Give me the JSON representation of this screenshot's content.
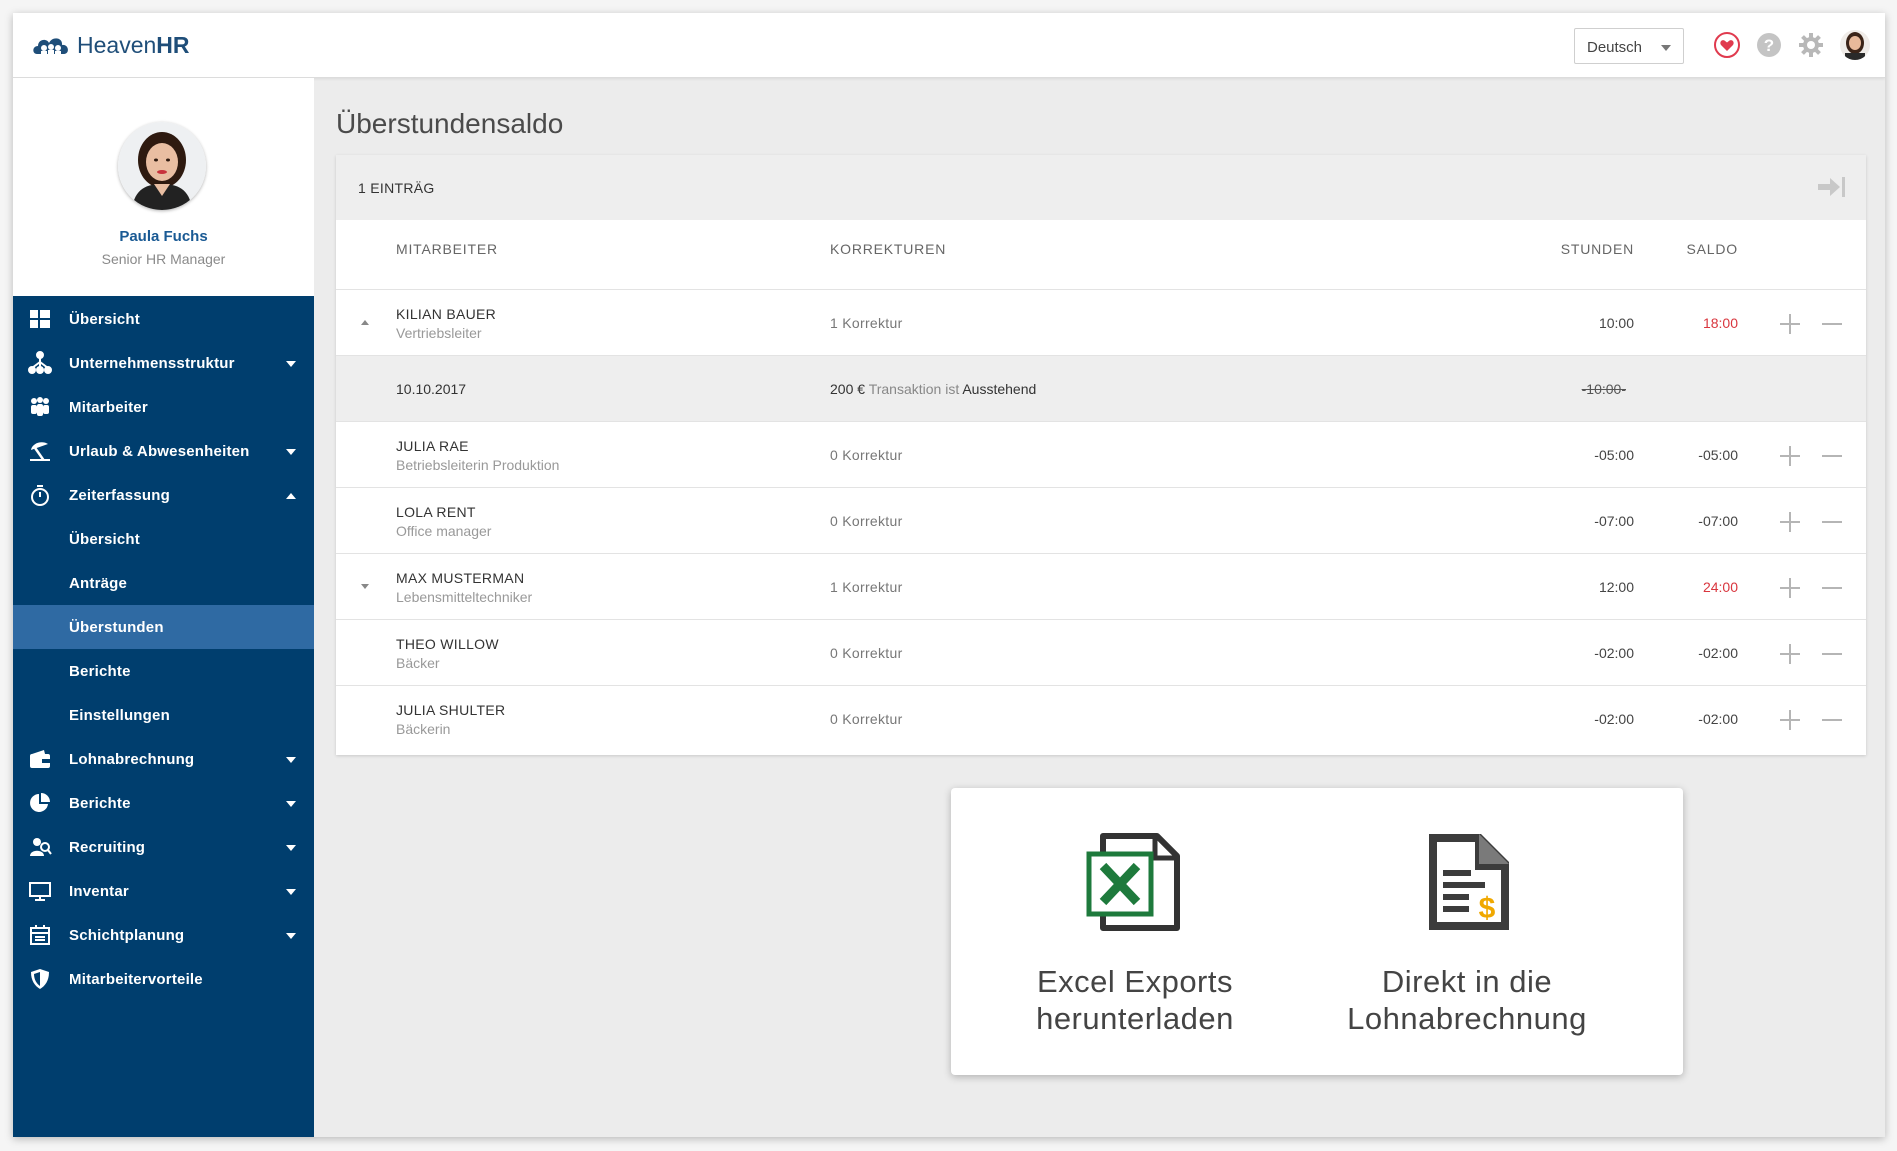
{
  "header": {
    "brand_light": "Heaven",
    "brand_bold": "HR",
    "language": "Deutsch"
  },
  "profile": {
    "name": "Paula Fuchs",
    "role": "Senior HR Manager"
  },
  "sidebar": {
    "items": [
      {
        "label": "Übersicht",
        "icon": "dashboard-icon",
        "dropdown": false
      },
      {
        "label": "Unternehmensstruktur",
        "icon": "org-structure-icon",
        "dropdown": true
      },
      {
        "label": "Mitarbeiter",
        "icon": "people-icon",
        "dropdown": false
      },
      {
        "label": "Urlaub & Abwesenheiten",
        "icon": "beach-umbrella-icon",
        "dropdown": true
      },
      {
        "label": "Zeiterfassung",
        "icon": "stopwatch-icon",
        "dropdown": true,
        "expanded": true
      },
      {
        "label": "Übersicht",
        "sub": true
      },
      {
        "label": "Anträge",
        "sub": true
      },
      {
        "label": "Überstunden",
        "sub": true,
        "active": true
      },
      {
        "label": "Berichte",
        "sub": true
      },
      {
        "label": "Einstellungen",
        "sub": true
      },
      {
        "label": "Lohnabrechnung",
        "icon": "wallet-icon",
        "dropdown": true
      },
      {
        "label": "Berichte",
        "icon": "pie-chart-icon",
        "dropdown": true
      },
      {
        "label": "Recruiting",
        "icon": "recruiting-icon",
        "dropdown": true
      },
      {
        "label": "Inventar",
        "icon": "monitor-icon",
        "dropdown": true
      },
      {
        "label": "Schichtplanung",
        "icon": "calendar-icon",
        "dropdown": true
      },
      {
        "label": "Mitarbeitervorteile",
        "icon": "shield-icon",
        "dropdown": false
      }
    ]
  },
  "main": {
    "title": "Überstundensaldo",
    "entry_count": "1 EINTRÄG",
    "columns": {
      "employee": "MITARBEITER",
      "corrections": "KORREKTUREN",
      "hours": "STUNDEN",
      "balance": "SALDO"
    },
    "rows": [
      {
        "name": "KILIAN BAUER",
        "role": "Vertriebsleiter",
        "corrections": "1 Korrektur",
        "hours": "10:00",
        "balance": "18:00",
        "balance_highlight": true,
        "toggle": "up"
      },
      {
        "detail": true,
        "date": "10.10.2017",
        "amount": "200 €",
        "trans_mid": "Transaktion ist",
        "trans_status": "Ausstehend",
        "struck_hours": "-10:00-"
      },
      {
        "name": "JULIA RAE",
        "role": "Betriebsleiterin Produktion",
        "corrections": "0 Korrektur",
        "hours": "-05:00",
        "balance": "-05:00"
      },
      {
        "name": "LOLA RENT",
        "role": "Office manager",
        "corrections": "0 Korrektur",
        "hours": "-07:00",
        "balance": "-07:00"
      },
      {
        "name": "MAX MUSTERMAN",
        "role": "Lebensmitteltechniker",
        "corrections": "1 Korrektur",
        "hours": "12:00",
        "balance": "24:00",
        "balance_highlight": true,
        "toggle": "down"
      },
      {
        "name": "THEO WILLOW",
        "role": "Bäcker",
        "corrections": "0 Korrektur",
        "hours": "-02:00",
        "balance": "-02:00"
      },
      {
        "name": "JULIA SHULTER",
        "role": "Bäckerin",
        "corrections": "0 Korrektur",
        "hours": "-02:00",
        "balance": "-02:00"
      }
    ]
  },
  "promo": {
    "excel_line1": "Excel Exports",
    "excel_line2": "herunterladen",
    "payroll_line1": "Direkt in die",
    "payroll_line2": "Lohnabrechnung"
  },
  "colors": {
    "sidebar": "#003e6e",
    "sidebar_active": "#2f6aa3",
    "brand": "#1f4e79",
    "highlight_red": "#d9363e",
    "excel_green": "#1e7a3c"
  }
}
